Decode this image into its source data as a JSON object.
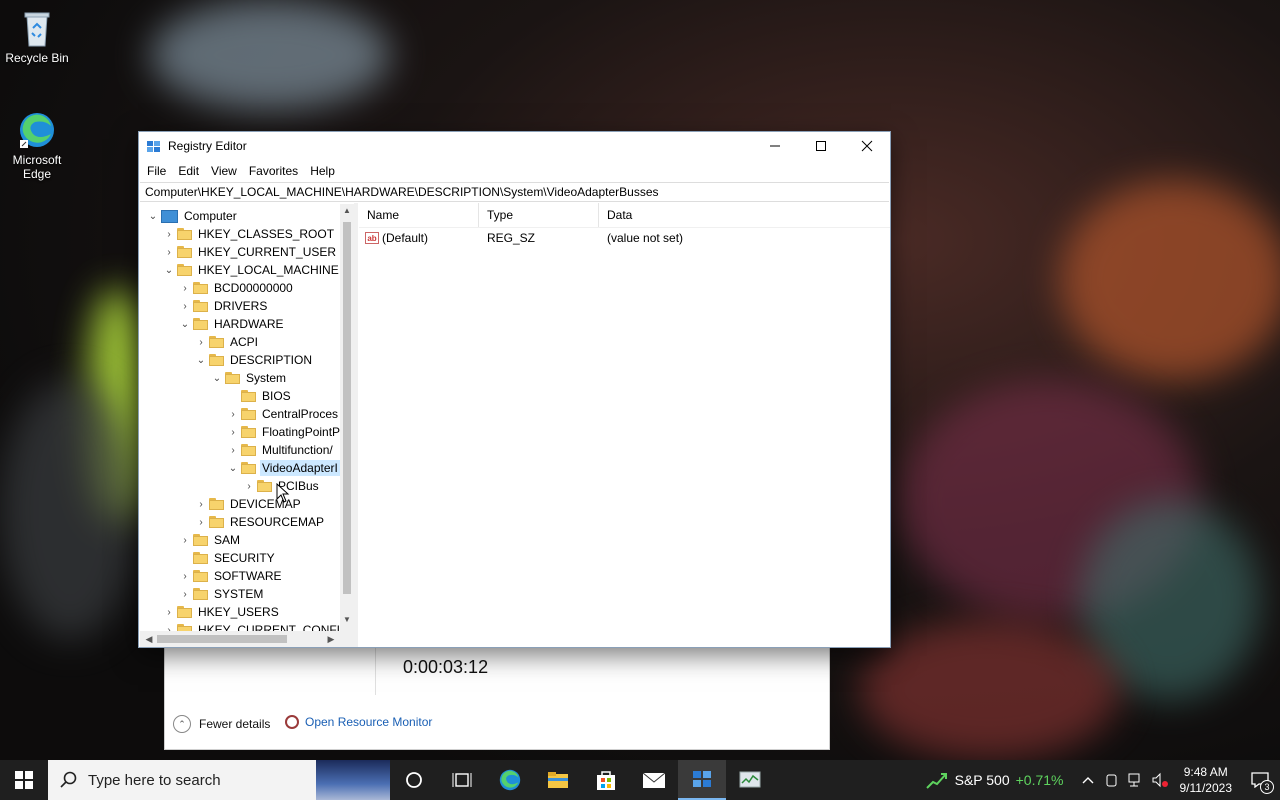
{
  "desktop": {
    "icons": [
      {
        "label": "Recycle Bin"
      },
      {
        "label": "Microsoft Edge"
      }
    ]
  },
  "task_manager": {
    "uptime_value": "0:00:03:12",
    "fewer_details": "Fewer details",
    "open_resource_monitor": "Open Resource Monitor"
  },
  "regedit": {
    "title": "Registry Editor",
    "menu": [
      "File",
      "Edit",
      "View",
      "Favorites",
      "Help"
    ],
    "address": "Computer\\HKEY_LOCAL_MACHINE\\HARDWARE\\DESCRIPTION\\System\\VideoAdapterBusses",
    "tree": [
      {
        "label": "Computer",
        "level": 0,
        "expander": "open",
        "icon": "computer-icon"
      },
      {
        "label": "HKEY_CLASSES_ROOT",
        "level": 1,
        "expander": "closed"
      },
      {
        "label": "HKEY_CURRENT_USER",
        "level": 1,
        "expander": "closed"
      },
      {
        "label": "HKEY_LOCAL_MACHINE",
        "level": 1,
        "expander": "open"
      },
      {
        "label": "BCD00000000",
        "level": 2,
        "expander": "closed"
      },
      {
        "label": "DRIVERS",
        "level": 2,
        "expander": "closed"
      },
      {
        "label": "HARDWARE",
        "level": 2,
        "expander": "open"
      },
      {
        "label": "ACPI",
        "level": 3,
        "expander": "closed"
      },
      {
        "label": "DESCRIPTION",
        "level": 3,
        "expander": "open"
      },
      {
        "label": "System",
        "level": 4,
        "expander": "open"
      },
      {
        "label": "BIOS",
        "level": 5,
        "expander": "none"
      },
      {
        "label": "CentralProces",
        "level": 5,
        "expander": "closed"
      },
      {
        "label": "FloatingPointP",
        "level": 5,
        "expander": "closed"
      },
      {
        "label": "Multifunction/",
        "level": 5,
        "expander": "closed"
      },
      {
        "label": "VideoAdapterI",
        "level": 5,
        "expander": "open",
        "selected": true
      },
      {
        "label": "PCIBus",
        "level": 6,
        "expander": "closed"
      },
      {
        "label": "DEVICEMAP",
        "level": 3,
        "expander": "closed"
      },
      {
        "label": "RESOURCEMAP",
        "level": 3,
        "expander": "closed"
      },
      {
        "label": "SAM",
        "level": 2,
        "expander": "closed"
      },
      {
        "label": "SECURITY",
        "level": 2,
        "expander": "none"
      },
      {
        "label": "SOFTWARE",
        "level": 2,
        "expander": "closed"
      },
      {
        "label": "SYSTEM",
        "level": 2,
        "expander": "closed"
      },
      {
        "label": "HKEY_USERS",
        "level": 1,
        "expander": "closed"
      },
      {
        "label": "HKEY_CURRENT_CONFIG",
        "level": 1,
        "expander": "closed"
      }
    ],
    "columns": [
      "Name",
      "Type",
      "Data"
    ],
    "values": [
      {
        "name": "(Default)",
        "type": "REG_SZ",
        "data": "(value not set)"
      }
    ]
  },
  "taskbar": {
    "search_placeholder": "Type here to search",
    "stock_name": "S&P 500",
    "stock_change": "+0.71%",
    "time": "9:48 AM",
    "date": "9/11/2023",
    "notification_count": "3"
  }
}
